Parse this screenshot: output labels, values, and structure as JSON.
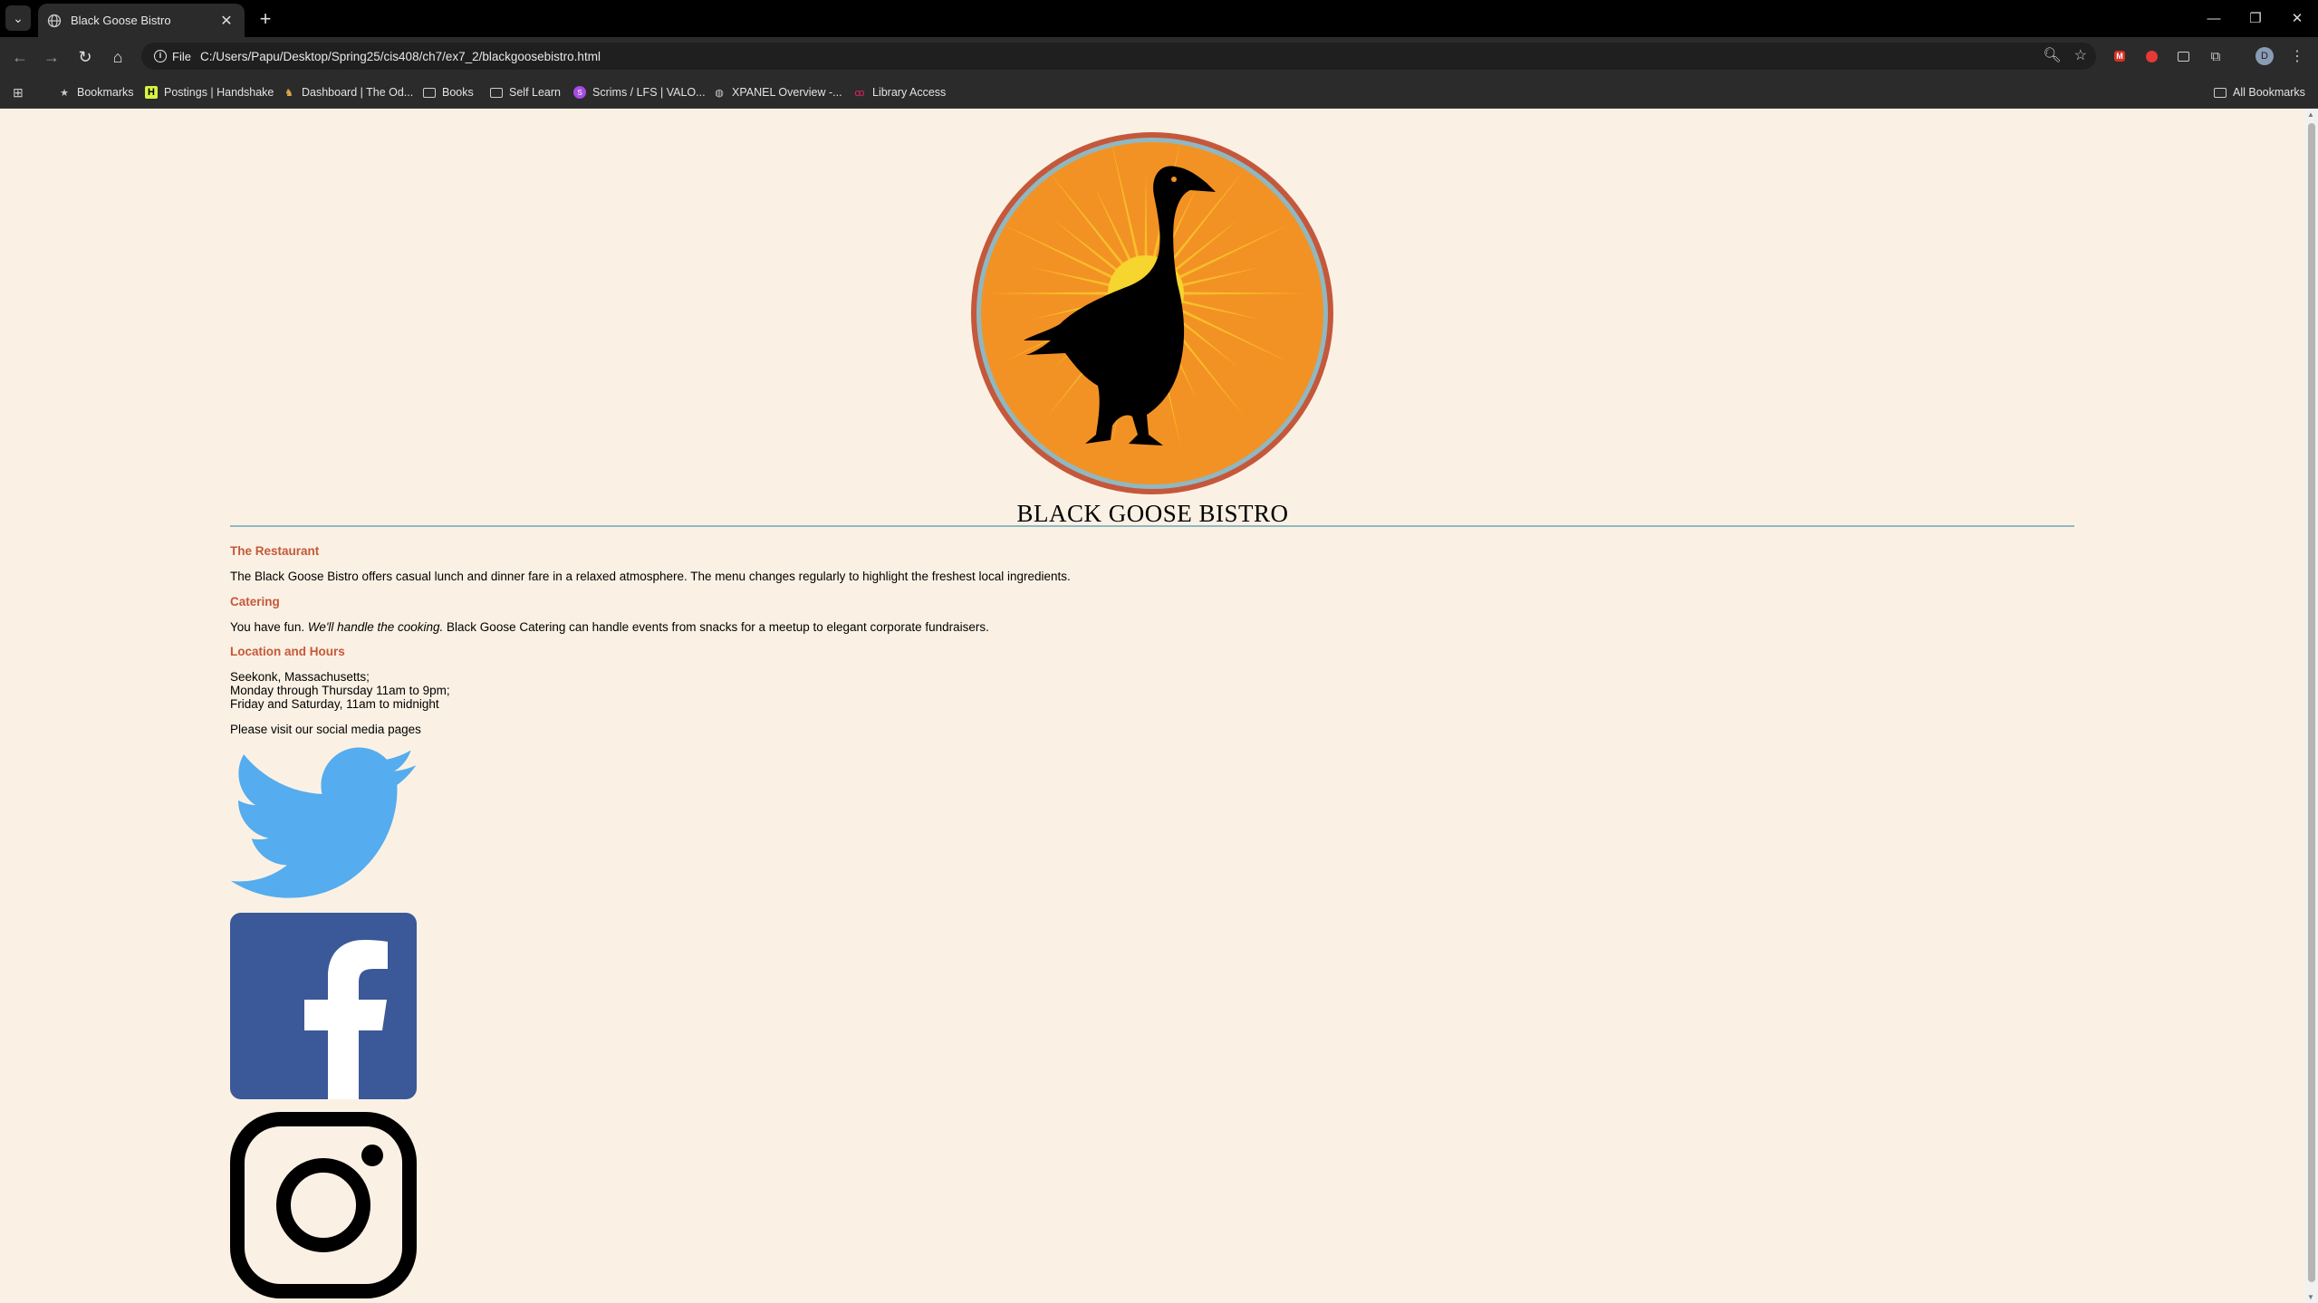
{
  "browser": {
    "tab_title": "Black Goose Bistro",
    "url_scheme_label": "File",
    "url": "C:/Users/Papu/Desktop/Spring25/cis408/ch7/ex7_2/blackgoosebistro.html",
    "profile_initial": "D"
  },
  "bookmarks": {
    "items": [
      {
        "label": "Bookmarks",
        "icon": "star-icon"
      },
      {
        "label": "Postings | Handshake",
        "icon": "handshake-icon"
      },
      {
        "label": "Dashboard | The Od...",
        "icon": "owl-icon"
      },
      {
        "label": "Books",
        "icon": "folder-icon"
      },
      {
        "label": "Self Learn",
        "icon": "folder-icon"
      },
      {
        "label": "Scrims / LFS | VALO...",
        "icon": "scrims-icon"
      },
      {
        "label": "XPANEL Overview -...",
        "icon": "globe-icon"
      },
      {
        "label": "Library Access",
        "icon": "library-icon"
      }
    ],
    "all_bookmarks": "All Bookmarks"
  },
  "page": {
    "site_title": "BLACK GOOSE BISTRO",
    "sections": {
      "restaurant_heading": "The Restaurant",
      "restaurant_text": "The Black Goose Bistro offers casual lunch and dinner fare in a relaxed atmosphere. The menu changes regularly to highlight the freshest local ingredients.",
      "catering_heading": "Catering",
      "catering_text_prefix": "You have fun.",
      "catering_text_em": "We'll handle the cooking.",
      "catering_text_suffix": "Black Goose Catering can handle events from snacks for a meetup to elegant corporate fundraisers.",
      "location_heading": "Location and Hours",
      "location_line1": "Seekonk, Massachusetts;",
      "location_line2": "Monday through Thursday 11am to 9pm;",
      "location_line3": "Friday and Saturday, 11am to midnight",
      "social_text": "Please visit our social media pages"
    },
    "colors": {
      "background": "#faf1e4",
      "heading": "#c5583a",
      "rule": "#8fb8c2",
      "twitter": "#55acee",
      "facebook": "#3b5998"
    }
  }
}
